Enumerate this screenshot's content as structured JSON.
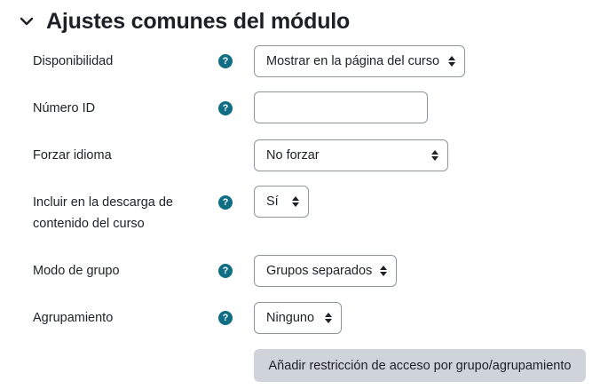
{
  "section": {
    "title": "Ajustes comunes del módulo"
  },
  "fields": {
    "availability": {
      "label": "Disponibilidad",
      "value": "Mostrar en la página del curso"
    },
    "idnumber": {
      "label": "Número ID",
      "value": ""
    },
    "force_language": {
      "label": "Forzar idioma",
      "value": "No forzar"
    },
    "download_content": {
      "label_line1": "Incluir en la descarga de",
      "label_line2": "contenido del curso",
      "value": "Sí"
    },
    "group_mode": {
      "label": "Modo de grupo",
      "value": "Grupos separados"
    },
    "grouping": {
      "label": "Agrupamiento",
      "value": "Ninguno"
    }
  },
  "help_symbol": "?",
  "add_restriction_button": "Añadir restricción de acceso por grupo/agrupamiento",
  "colors": {
    "help_icon": "#0f6e84",
    "button_bg": "#ced4da",
    "border": "#8f959e"
  },
  "icons": {
    "collapse": "chevron-down-icon",
    "help": "help-icon",
    "select_caret": "sort-caret-icon"
  }
}
